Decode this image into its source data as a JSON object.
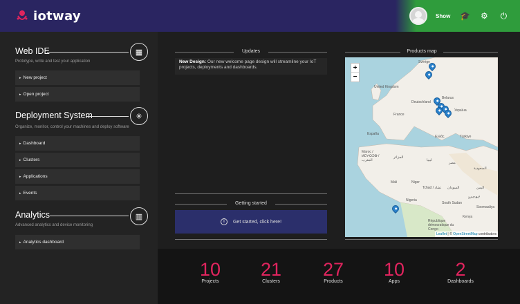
{
  "brand": {
    "name": "iotway"
  },
  "user": {
    "name": "Show"
  },
  "sections": [
    {
      "title": "Web IDE",
      "subtitle": "Prototype, write and test your application",
      "items": [
        "New project",
        "Open project"
      ]
    },
    {
      "title": "Deployment System",
      "subtitle": "Organize, monitor, control your machines and deploy software",
      "items": [
        "Dashboard",
        "Clusters",
        "Applications",
        "Events"
      ]
    },
    {
      "title": "Analytics",
      "subtitle": "Advanced analytics and device monitoring",
      "items": [
        "Analytics dashboard"
      ]
    }
  ],
  "updates": {
    "title": "Updates",
    "lead": "New Design:",
    "text": " Our new welcome page design will streamline your IoT projects, deployments and dashboards."
  },
  "getting_started": {
    "title": "Getting started",
    "button": "Get started, click here!"
  },
  "map": {
    "title": "Products map",
    "zoom_in": "+",
    "zoom_out": "−",
    "attribution_leaflet": "Leaflet",
    "attribution_osm": "OpenStreetMap",
    "attribution_suffix": " contributors",
    "labels": [
      "Sverige",
      "United Kingdom",
      "Deutschland",
      "Belarus",
      "France",
      "Україна",
      "España",
      "Ελλάς",
      "Türkiye",
      "Maroc / ⵍⵎⵖⵔⵉⴱ / المغرب",
      "الجزائر",
      "ليبيا",
      "مصر",
      "Mali",
      "Niger",
      "Tchad / تشاد",
      "السودان",
      "Nigeria",
      "South Sudan",
      "ኢትዮጵያ",
      "Kenya",
      "République démocratique du Congo",
      "Soomaaliya",
      "السعودية",
      "اليمن"
    ]
  },
  "stats": [
    {
      "value": "10",
      "label": "Projects"
    },
    {
      "value": "21",
      "label": "Clusters"
    },
    {
      "value": "27",
      "label": "Products"
    },
    {
      "value": "10",
      "label": "Apps"
    },
    {
      "value": "2",
      "label": "Dashboards"
    }
  ]
}
